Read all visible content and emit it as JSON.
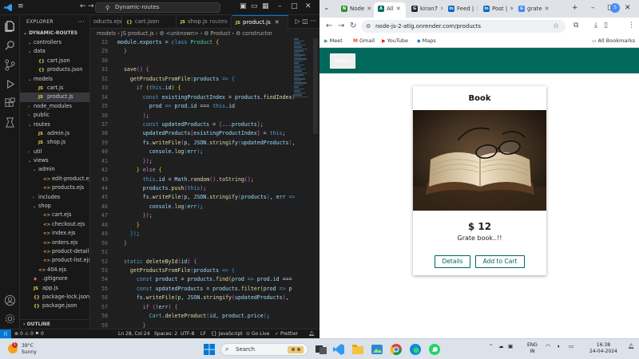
{
  "vscode": {
    "search_text": "Dynamic-routes",
    "explorer_title": "EXPLORER",
    "root_folder": "DYNAMIC-ROUTES",
    "outline_label": "OUTLINE",
    "tree": [
      {
        "label": "controllers",
        "type": "folder",
        "level": 1,
        "open": true
      },
      {
        "label": "data",
        "type": "folder",
        "level": 1,
        "open": true
      },
      {
        "label": "cart.json",
        "type": "json",
        "level": 2
      },
      {
        "label": "products.json",
        "type": "json",
        "level": 2
      },
      {
        "label": "models",
        "type": "folder",
        "level": 1,
        "open": true
      },
      {
        "label": "cart.js",
        "type": "js",
        "level": 2
      },
      {
        "label": "product.js",
        "type": "js",
        "level": 2,
        "active": true
      },
      {
        "label": "node_modules",
        "type": "folder",
        "level": 1,
        "open": false
      },
      {
        "label": "public",
        "type": "folder",
        "level": 1,
        "open": false
      },
      {
        "label": "routes",
        "type": "folder",
        "level": 1,
        "open": true
      },
      {
        "label": "admin.js",
        "type": "js",
        "level": 2
      },
      {
        "label": "shop.js",
        "type": "js",
        "level": 2
      },
      {
        "label": "util",
        "type": "folder",
        "level": 1,
        "open": false
      },
      {
        "label": "views",
        "type": "folder",
        "level": 1,
        "open": true
      },
      {
        "label": "admin",
        "type": "folder",
        "level": 2,
        "open": true
      },
      {
        "label": "edit-product.ejs",
        "type": "ejs",
        "level": 3
      },
      {
        "label": "products.ejs",
        "type": "ejs",
        "level": 3
      },
      {
        "label": "includes",
        "type": "folder",
        "level": 2,
        "open": false
      },
      {
        "label": "shop",
        "type": "folder",
        "level": 2,
        "open": true
      },
      {
        "label": "cart.ejs",
        "type": "ejs",
        "level": 3
      },
      {
        "label": "checkout.ejs",
        "type": "ejs",
        "level": 3
      },
      {
        "label": "index.ejs",
        "type": "ejs",
        "level": 3
      },
      {
        "label": "orders.ejs",
        "type": "ejs",
        "level": 3
      },
      {
        "label": "product-detail.ejs",
        "type": "ejs",
        "level": 3
      },
      {
        "label": "product-list.ejs",
        "type": "ejs",
        "level": 3
      },
      {
        "label": "404.ejs",
        "type": "ejs",
        "level": 2
      },
      {
        "label": ".gitignore",
        "type": "git",
        "level": 1
      },
      {
        "label": "app.js",
        "type": "js",
        "level": 1
      },
      {
        "label": "package-lock.json",
        "type": "json",
        "level": 1
      },
      {
        "label": "package.json",
        "type": "json",
        "level": 1
      }
    ],
    "tabs": [
      {
        "label": "oducts.ejs",
        "type": "ejs"
      },
      {
        "label": "cart.json",
        "type": "json"
      },
      {
        "label": "shop.js",
        "suffix": "routes",
        "type": "js"
      },
      {
        "label": "product.js",
        "type": "js",
        "active": true
      }
    ],
    "breadcrumb": "models  ›  JS product.js  ›  ⚙ <unknown>  ›  ⚙ Product  ›  ⚙ constructor",
    "code_lines": [
      {
        "n": "22",
        "html": "<span class='v'>module</span>.<span class='v'>exports</span> = <span class='k'>class</span> <span class='c'>Product</span> <span class='p'>{</span>"
      },
      {
        "n": "29",
        "html": "  <span class='pp'>}</span>"
      },
      {
        "n": "30",
        "html": ""
      },
      {
        "n": "31",
        "html": "  <span class='f'>save</span><span class='pp'>()</span> <span class='pp'>{</span>"
      },
      {
        "n": "32",
        "html": "    <span class='f'>getProductsFromFile</span><span class='pb'>(</span><span class='v'>products</span> <span class='k'>=&gt;</span> <span class='pb'>{</span>"
      },
      {
        "n": "33",
        "html": "      <span class='kc'>if</span> <span class='p'>(</span><span class='k'>this</span>.<span class='v'>id</span><span class='p'>)</span> <span class='p'>{</span>"
      },
      {
        "n": "34",
        "html": "        <span class='k'>const</span> <span class='v'>existingProductIndex</span> = <span class='v'>products</span>.<span class='f'>findIndex</span><span class='pp'>(</span>"
      },
      {
        "n": "35",
        "html": "          <span class='v'>prod</span> <span class='k'>=&gt;</span> <span class='v'>prod</span>.<span class='v'>id</span> === <span class='k'>this</span>.<span class='v'>id</span>"
      },
      {
        "n": "36",
        "html": "        <span class='pp'>)</span>;"
      },
      {
        "n": "37",
        "html": "        <span class='k'>const</span> <span class='v'>updatedProducts</span> = <span class='pp'>[</span>...<span class='v'>products</span><span class='pp'>]</span>;"
      },
      {
        "n": "38",
        "html": "        <span class='v'>updatedProducts</span><span class='pp'>[</span><span class='v'>existingProductIndex</span><span class='pp'>]</span> = <span class='k'>this</span>;"
      },
      {
        "n": "39",
        "html": "        <span class='v'>fs</span>.<span class='f'>writeFile</span><span class='pp'>(</span><span class='v'>p</span>, <span class='v'>JSON</span>.<span class='f'>stringify</span><span class='pb'>(</span><span class='v'>updatedProducts</span><span class='pb'>)</span>,"
      },
      {
        "n": "40",
        "html": "          <span class='v'>console</span>.<span class='f'>log</span><span class='pb'>(</span><span class='v'>err</span><span class='pb'>)</span>;"
      },
      {
        "n": "41",
        "html": "        <span class='pp'>})</span>;"
      },
      {
        "n": "42",
        "html": "      <span class='p'>}</span> <span class='kc'>else</span> <span class='p'>{</span>"
      },
      {
        "n": "43",
        "html": "        <span class='k'>this</span>.<span class='v'>id</span> = <span class='v'>Math</span>.<span class='f'>random</span><span class='pp'>()</span>.<span class='f'>toString</span><span class='pp'>()</span>;"
      },
      {
        "n": "44",
        "html": "        <span class='v'>products</span>.<span class='f'>push</span><span class='pp'>(</span><span class='k'>this</span><span class='pp'>)</span>;"
      },
      {
        "n": "45",
        "html": "        <span class='v'>fs</span>.<span class='f'>writeFile</span><span class='pp'>(</span><span class='v'>p</span>, <span class='v'>JSON</span>.<span class='f'>stringify</span><span class='pb'>(</span><span class='v'>products</span><span class='pb'>)</span>, <span class='v'>err</span> <span class='k'>=&gt;</span>"
      },
      {
        "n": "46",
        "html": "          <span class='v'>console</span>.<span class='f'>log</span><span class='pb'>(</span><span class='v'>err</span><span class='pb'>)</span>;"
      },
      {
        "n": "47",
        "html": "        <span class='pp'>})</span>;"
      },
      {
        "n": "48",
        "html": "      <span class='p'>}</span>"
      },
      {
        "n": "49",
        "html": "    <span class='pb'>})</span>;"
      },
      {
        "n": "50",
        "html": "  <span class='pp'>}</span>"
      },
      {
        "n": "51",
        "html": ""
      },
      {
        "n": "52",
        "html": "  <span class='k'>static</span> <span class='f'>deleteById</span><span class='pp'>(</span><span class='v'>id</span><span class='pp'>)</span> <span class='pp'>{</span>"
      },
      {
        "n": "53",
        "html": "    <span class='f'>getProductsFromFile</span><span class='pb'>(</span><span class='v'>products</span> <span class='k'>=&gt;</span> <span class='pb'>{</span>"
      },
      {
        "n": "54",
        "html": "      <span class='k'>const</span> <span class='v'>product</span> = <span class='v'>products</span>.<span class='f'>find</span><span class='p'>(</span><span class='v'>prod</span> <span class='k'>=&gt;</span> <span class='v'>prod</span>.<span class='v'>id</span> ==="
      },
      {
        "n": "55",
        "html": "      <span class='k'>const</span> <span class='v'>updatedProducts</span> = <span class='v'>products</span>.<span class='f'>filter</span><span class='p'>(</span><span class='v'>prod</span> <span class='k'>=&gt;</span> <span class='v'>p</span>"
      },
      {
        "n": "56",
        "html": "      <span class='v'>fs</span>.<span class='f'>writeFile</span><span class='p'>(</span><span class='v'>p</span>, <span class='v'>JSON</span>.<span class='f'>stringify</span><span class='pp'>(</span><span class='v'>updatedProducts</span><span class='pp'>)</span>,"
      },
      {
        "n": "57",
        "html": "        <span class='kc'>if</span> <span class='pp'>(</span>!<span class='v'>err</span><span class='pp'>)</span> <span class='pp'>{</span>"
      },
      {
        "n": "58",
        "html": "          <span class='c'>Cart</span>.<span class='f'>deleteProduct</span><span class='pb'>(</span><span class='v'>id</span>, <span class='v'>product</span>.<span class='v'>price</span><span class='pb'>)</span>;"
      },
      {
        "n": "59",
        "html": "        <span class='pp'>}</span>"
      },
      {
        "n": "60",
        "html": "      <span class='p'>})</span>;"
      },
      {
        "n": "61",
        "html": "    <span class='pb'>})</span>;"
      },
      {
        "n": "62",
        "html": "  <span class='pp'>}</span>"
      },
      {
        "n": "63",
        "html": ""
      },
      {
        "n": "64",
        "html": "  <span class='k'>static</span> <span class='f'>fetchAll</span><span class='pp'>(</span><span class='v'>cb</span><span class='pp'>)</span> <span class='pp'>{</span>"
      }
    ],
    "status": {
      "errors": "0",
      "warnings": "0",
      "info": "0",
      "position": "Ln 28, Col 24",
      "spaces": "Spaces: 2",
      "encoding": "UTF-8",
      "eol": "LF",
      "language": "JavaScript",
      "golive": "Go Live",
      "prettier": "Prettier"
    }
  },
  "browser": {
    "tabs": [
      {
        "label": "Node",
        "favicon_color": "#3c873a",
        "favicon": "N"
      },
      {
        "label": "All",
        "favicon_color": "#00695c",
        "favicon": "A",
        "active": true
      },
      {
        "label": "kiran7",
        "favicon_color": "#24292f",
        "favicon": "G"
      },
      {
        "label": "Feed |",
        "favicon_color": "#0a66c2",
        "favicon": "in"
      },
      {
        "label": "Post |",
        "favicon_color": "#0a66c2",
        "favicon": "in"
      },
      {
        "label": "grate",
        "favicon_color": "#4285f4",
        "favicon": "G"
      }
    ],
    "url": "node-js-2-atlg.onrender.com/products",
    "profile_initial": "S",
    "bookmarks": [
      {
        "label": "Meet",
        "icon_color": "#34a853",
        "icon": "▶"
      },
      {
        "label": "Gmail",
        "icon_color": "#ea4335",
        "icon": "M"
      },
      {
        "label": "YouTube",
        "icon_color": "#ff0000",
        "icon": "▶"
      },
      {
        "label": "Maps",
        "icon_color": "#1a73e8",
        "icon": "◆"
      }
    ],
    "all_bookmarks": "All Bookmarks"
  },
  "page": {
    "menu_label": "Menu",
    "product": {
      "title": "Book",
      "price": "$ 12",
      "description": "Grate book..!!",
      "details_label": "Details",
      "add_to_cart_label": "Add to Cart"
    }
  },
  "taskbar": {
    "temperature": "39°C",
    "condition": "Sunny",
    "notification_count": "1",
    "search_placeholder": "Search",
    "language": "ENG",
    "region": "IN",
    "time": "16:38",
    "date": "24-04-2024"
  },
  "colors": {
    "header_teal": "#00695c",
    "vscode_bg": "#1f1f1f",
    "accent_blue": "#0078d4"
  }
}
